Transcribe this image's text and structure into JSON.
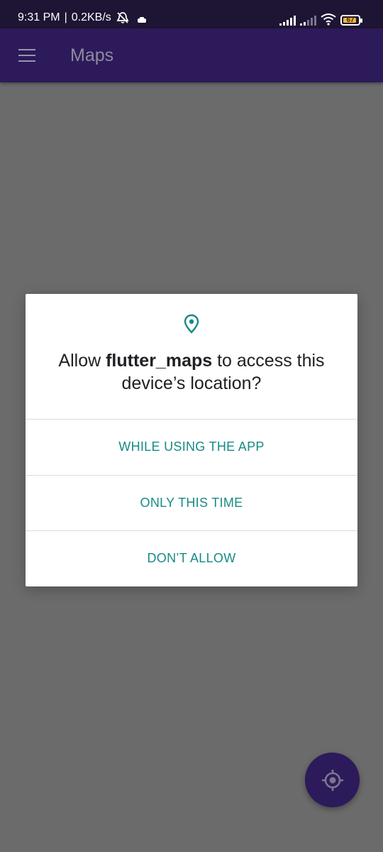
{
  "status_bar": {
    "time": "9:31 PM",
    "separator": "|",
    "speed": "0.2KB/s",
    "battery_level": "67"
  },
  "app_bar": {
    "title": "Maps",
    "menu_icon": "hamburger-menu-icon"
  },
  "dialog": {
    "icon": "location-pin-icon",
    "message_prefix": "Allow ",
    "app_name": "flutter_maps",
    "message_suffix": " to access this device’s location?",
    "options": [
      "WHILE USING THE APP",
      "ONLY THIS TIME",
      "DON’T ALLOW"
    ]
  },
  "fab": {
    "icon": "my-location-icon"
  },
  "colors": {
    "status_bar": "#1e1433",
    "app_bar": "#2c1a5a",
    "scrim": "#6b6b6b",
    "accent_teal": "#178b84",
    "battery_fill": "#f0b43a"
  }
}
